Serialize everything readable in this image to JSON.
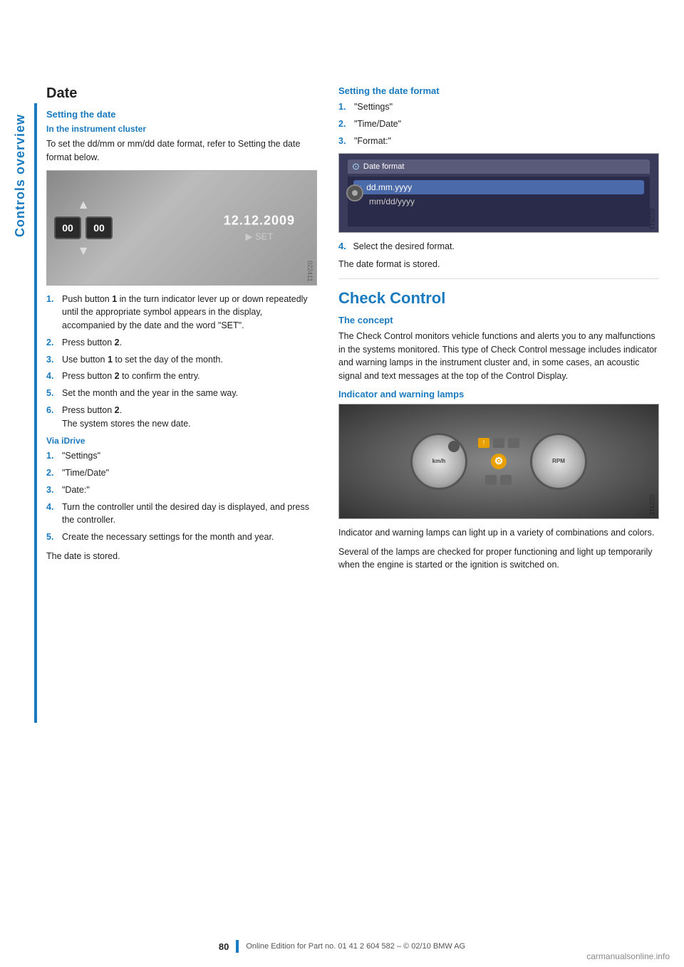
{
  "sidebar": {
    "label": "Controls overview"
  },
  "left_column": {
    "section_title": "Date",
    "setting_date_title": "Setting the date",
    "in_instrument_cluster_title": "In the instrument cluster",
    "instrument_cluster_text": "To set the dd/mm or mm/dd date format, refer to Setting the date format below.",
    "instrument_steps": [
      {
        "num": "1.",
        "text": "Push button ",
        "bold": "1",
        "text2": " in the turn indicator lever up or down repeatedly until the appropriate symbol appears in the display, accompanied by the date and the word \"SET\"."
      },
      {
        "num": "2.",
        "text": "Press button ",
        "bold": "2",
        "text2": "."
      },
      {
        "num": "3.",
        "text": "Use button ",
        "bold": "1",
        "text2": " to set the day of the month."
      },
      {
        "num": "4.",
        "text": "Press button ",
        "bold": "2",
        "text2": " to confirm the entry."
      },
      {
        "num": "5.",
        "text": "Set the month and the year in the same way.",
        "bold": "",
        "text2": ""
      },
      {
        "num": "6.",
        "text": "Press button ",
        "bold": "2",
        "text2": ".\nThe system stores the new date."
      }
    ],
    "via_idrive_title": "Via iDrive",
    "via_idrive_steps": [
      {
        "num": "1.",
        "text": "\"Settings\""
      },
      {
        "num": "2.",
        "text": "\"Time/Date\""
      },
      {
        "num": "3.",
        "text": "\"Date:\""
      },
      {
        "num": "4.",
        "text": "Turn the controller until the desired day is displayed, and press the controller."
      },
      {
        "num": "5.",
        "text": "Create the necessary settings for the month and year."
      }
    ],
    "date_stored_text": "The date is stored.",
    "date_display": {
      "date_value": "12.12.2009",
      "set_label": "▶ SET"
    }
  },
  "right_column": {
    "setting_date_format_title": "Setting the date format",
    "format_steps": [
      {
        "num": "1.",
        "text": "\"Settings\""
      },
      {
        "num": "2.",
        "text": "\"Time/Date\""
      },
      {
        "num": "3.",
        "text": "\"Format:\""
      }
    ],
    "format_step4": "Select the desired format.",
    "format_stored_text": "The date format is stored.",
    "date_format_options": [
      {
        "label": "dd.mm.yyyy",
        "selected": true
      },
      {
        "label": "mm/dd/yyyy",
        "selected": false
      }
    ],
    "date_format_window_title": "Date format",
    "check_control_title": "Check Control",
    "the_concept_title": "The concept",
    "the_concept_text": "The Check Control monitors vehicle functions and alerts you to any malfunctions in the systems monitored. This type of Check Control message includes indicator and warning lamps in the instrument cluster and, in some cases, an acoustic signal and text messages at the top of the Control Display.",
    "indicator_warning_title": "Indicator and warning lamps",
    "indicator_text1": "Indicator and warning lamps can light up in a variety of combinations and colors.",
    "indicator_text2": "Several of the lamps are checked for proper functioning and light up temporarily when the engine is started or the ignition is switched on."
  },
  "footer": {
    "page_number": "80",
    "footer_text": "Online Edition for Part no. 01 41 2 604 582 – © 02/10 BMW AG"
  }
}
